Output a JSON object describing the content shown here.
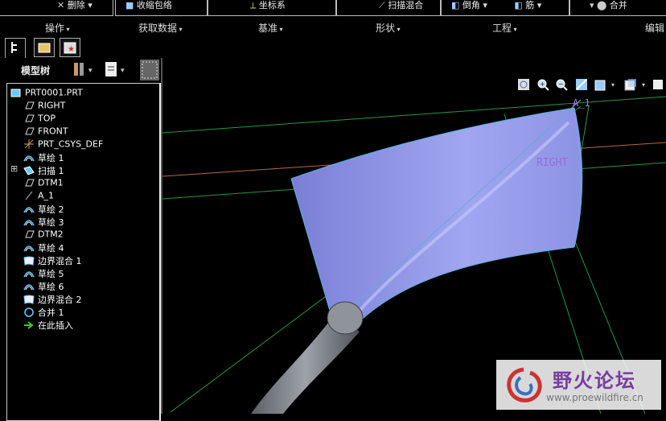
{
  "ribbon": {
    "buttons": [
      {
        "label": "删除",
        "icon": "delete-icon"
      },
      {
        "label": "收缩包络",
        "icon": "shrinkwrap-icon"
      },
      {
        "label": "坐标系",
        "icon": "csys-icon"
      },
      {
        "label": "扫描混合",
        "icon": "swept-blend-icon"
      },
      {
        "label": "倒角",
        "icon": "chamfer-icon"
      },
      {
        "label": "筋",
        "icon": "rib-icon"
      },
      {
        "label": "合并",
        "icon": "merge-icon"
      }
    ],
    "groups": [
      "操作",
      "获取数据",
      "基准",
      "形状",
      "工程",
      "编辑"
    ]
  },
  "tree": {
    "title": "模型树",
    "items": [
      {
        "label": "PRT0001.PRT",
        "icon": "part-icon"
      },
      {
        "label": "RIGHT",
        "icon": "datum-plane-icon"
      },
      {
        "label": "TOP",
        "icon": "datum-plane-icon"
      },
      {
        "label": "FRONT",
        "icon": "datum-plane-icon"
      },
      {
        "label": "PRT_CSYS_DEF",
        "icon": "csys-icon"
      },
      {
        "label": "草绘 1",
        "icon": "sketch-icon"
      },
      {
        "label": "扫描 1",
        "icon": "sweep-icon"
      },
      {
        "label": "DTM1",
        "icon": "datum-plane-icon"
      },
      {
        "label": "A_1",
        "icon": "datum-axis-icon"
      },
      {
        "label": "草绘 2",
        "icon": "sketch-icon"
      },
      {
        "label": "草绘 3",
        "icon": "sketch-icon"
      },
      {
        "label": "DTM2",
        "icon": "datum-plane-icon"
      },
      {
        "label": "草绘 4",
        "icon": "sketch-icon"
      },
      {
        "label": "边界混合 1",
        "icon": "boundary-blend-icon"
      },
      {
        "label": "草绘 5",
        "icon": "sketch-icon"
      },
      {
        "label": "草绘 6",
        "icon": "sketch-icon"
      },
      {
        "label": "边界混合 2",
        "icon": "boundary-blend-icon"
      },
      {
        "label": "合并 1",
        "icon": "merge-icon"
      },
      {
        "label": "在此插入",
        "icon": "insert-here-arrow-icon"
      }
    ]
  },
  "viewport": {
    "labels": {
      "axis": "A_1",
      "plane": "RIGHT"
    },
    "tools": [
      "refit-icon",
      "zoom-in-icon",
      "zoom-out-icon",
      "repaint-icon",
      "saved-views-icon",
      "display-style-icon",
      "view-manager-icon"
    ]
  },
  "watermark": {
    "title": "野火论坛",
    "url": "www.proewildfire.cn"
  },
  "colors": {
    "surface": "#8f95e6",
    "datum": "#1f9a4a",
    "axis": "#6aa9d8",
    "pipe": "#8a8f96"
  }
}
